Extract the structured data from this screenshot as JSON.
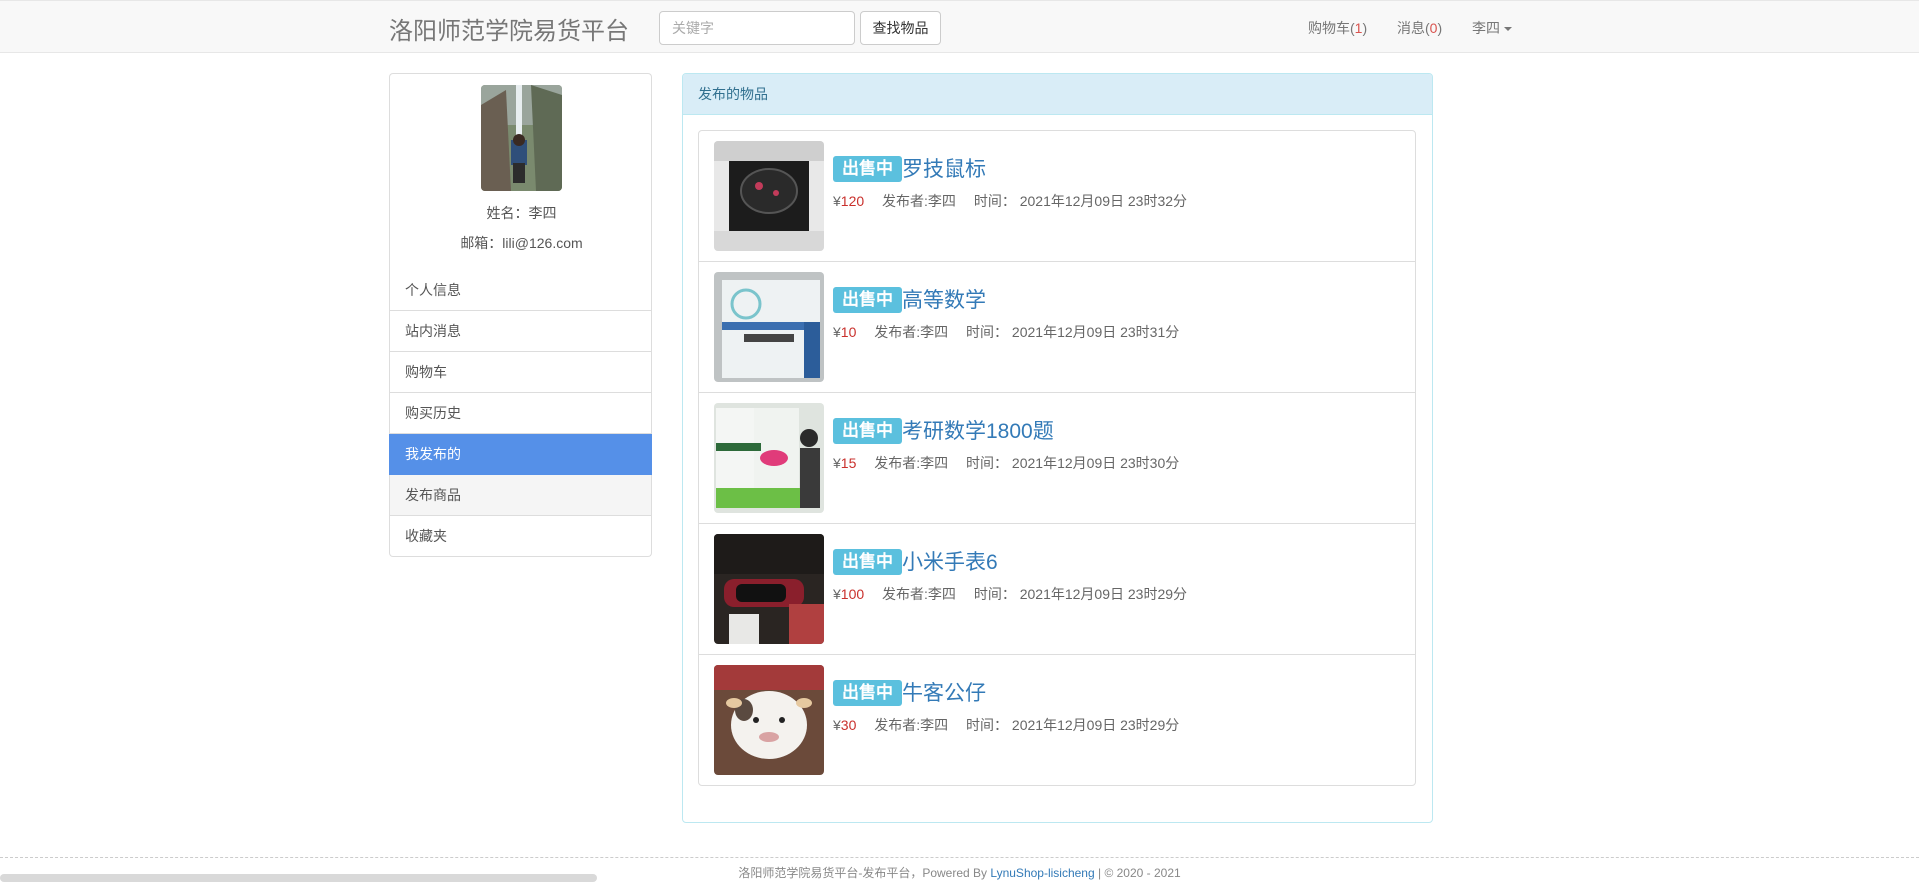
{
  "navbar": {
    "brand": "洛阳师范学院易货平台",
    "search_placeholder": "关键字",
    "search_button": "查找物品",
    "cart_label": "购物车(",
    "cart_count": "1",
    "cart_suffix": ")",
    "messages_label": "消息(",
    "messages_count": "0",
    "messages_suffix": ")",
    "user_name": "李四"
  },
  "profile": {
    "name_line": "姓名：李四",
    "email_line": "邮箱：lili@126.com"
  },
  "sidebar": {
    "items": [
      {
        "label": "个人信息"
      },
      {
        "label": "站内消息"
      },
      {
        "label": "购物车"
      },
      {
        "label": "购买历史"
      },
      {
        "label": "我发布的"
      },
      {
        "label": "发布商品"
      },
      {
        "label": "收藏夹"
      }
    ],
    "active_item": "我发布的"
  },
  "panel": {
    "heading": "发布的物品",
    "items": [
      {
        "status": "出售中",
        "title": "罗技鼠标",
        "price": "120",
        "publisher": "发布者:李四",
        "time": "时间：  2021年12月09日 23时32分",
        "thumb_icon": "mouse-photo"
      },
      {
        "status": "出售中",
        "title": "高等数学",
        "price": "10",
        "publisher": "发布者:李四",
        "time": "时间：  2021年12月09日 23时31分",
        "thumb_icon": "textbook-photo"
      },
      {
        "status": "出售中",
        "title": "考研数学1800题",
        "price": "15",
        "publisher": "发布者:李四",
        "time": "时间：  2021年12月09日 23时30分",
        "thumb_icon": "exam-book-photo"
      },
      {
        "status": "出售中",
        "title": "小米手表6",
        "price": "100",
        "publisher": "发布者:李四",
        "time": "时间：  2021年12月09日 23时29分",
        "thumb_icon": "watch-photo"
      },
      {
        "status": "出售中",
        "title": "牛客公仔",
        "price": "30",
        "publisher": "发布者:李四",
        "time": "时间：  2021年12月09日 23时29分",
        "thumb_icon": "plush-photo"
      }
    ],
    "currency": "¥"
  },
  "footer": {
    "text": "洛阳师范学院易货平台-发布平台，Powered By ",
    "link": "LynuShop-lisicheng",
    "suffix": " | © 2020 - 2021"
  },
  "colors": {
    "accent": "#5590e8",
    "badge": "#5bc0de",
    "title_link": "#337ab7",
    "price": "#c9302c"
  }
}
